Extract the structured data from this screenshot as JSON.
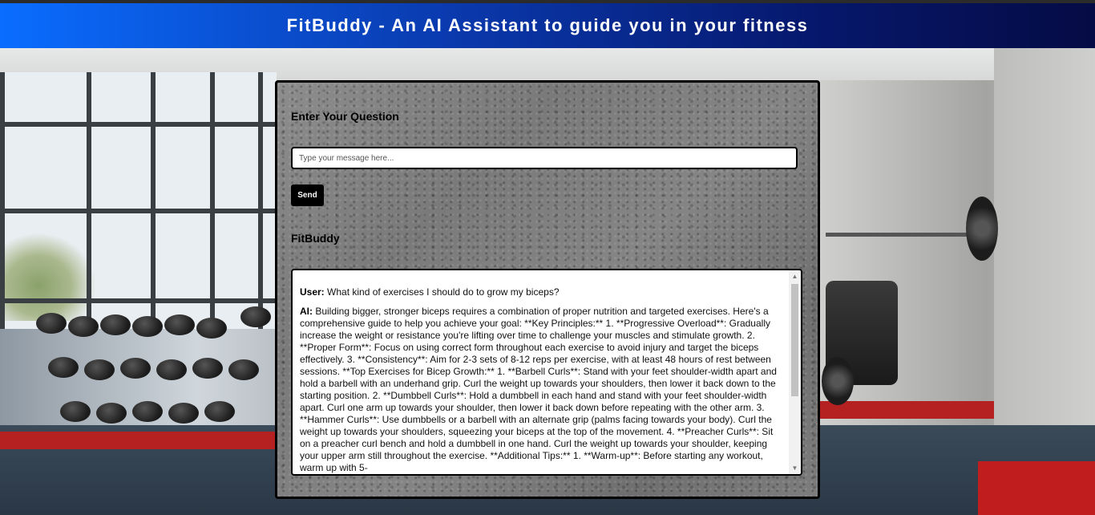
{
  "header": {
    "title": "FitBuddy - An AI Assistant to guide you in your fitness"
  },
  "form": {
    "question_label": "Enter Your Question",
    "input_placeholder": "Type your message here...",
    "input_value": "",
    "send_label": "Send"
  },
  "chat": {
    "title": "FitBuddy",
    "messages": [
      {
        "speaker": "User:",
        "text": " What kind of exercises I should do to grow my biceps?"
      },
      {
        "speaker": "AI:",
        "text": " Building bigger, stronger biceps requires a combination of proper nutrition and targeted exercises. Here's a comprehensive guide to help you achieve your goal: **Key Principles:** 1. **Progressive Overload**: Gradually increase the weight or resistance you're lifting over time to challenge your muscles and stimulate growth. 2. **Proper Form**: Focus on using correct form throughout each exercise to avoid injury and target the biceps effectively. 3. **Consistency**: Aim for 2-3 sets of 8-12 reps per exercise, with at least 48 hours of rest between sessions. **Top Exercises for Bicep Growth:** 1. **Barbell Curls**: Stand with your feet shoulder-width apart and hold a barbell with an underhand grip. Curl the weight up towards your shoulders, then lower it back down to the starting position. 2. **Dumbbell Curls**: Hold a dumbbell in each hand and stand with your feet shoulder-width apart. Curl one arm up towards your shoulder, then lower it back down before repeating with the other arm. 3. **Hammer Curls**: Use dumbbells or a barbell with an alternate grip (palms facing towards your body). Curl the weight up towards your shoulders, squeezing your biceps at the top of the movement. 4. **Preacher Curls**: Sit on a preacher curl bench and hold a dumbbell in one hand. Curl the weight up towards your shoulder, keeping your upper arm still throughout the exercise. **Additional Tips:** 1. **Warm-up**: Before starting any workout, warm up with 5-"
      }
    ]
  },
  "icons": {
    "scroll_up": "scroll-up-arrow-icon",
    "scroll_down": "scroll-down-arrow-icon"
  },
  "colors": {
    "header_start": "#0a6dff",
    "header_end": "#050b44",
    "button": "#000000"
  }
}
